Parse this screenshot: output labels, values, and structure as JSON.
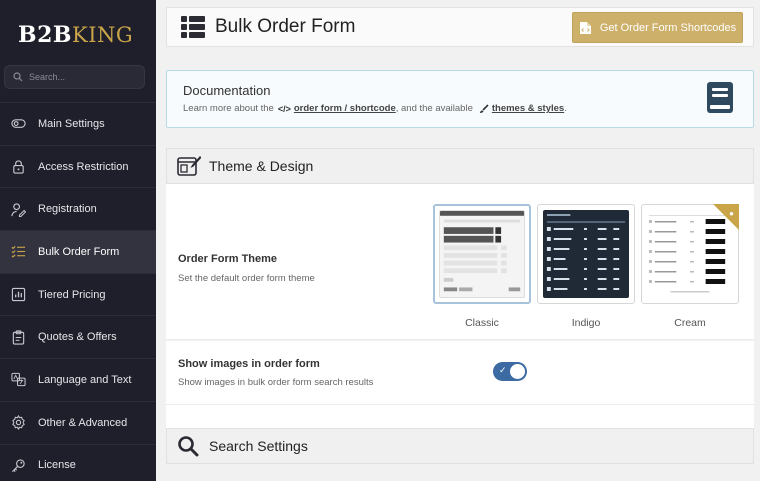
{
  "brand": {
    "logo_b2b": "B2B",
    "logo_king": "KING",
    "accent": "#c9a449"
  },
  "sidebar": {
    "search_placeholder": "Search...",
    "items": [
      {
        "label": "Main Settings",
        "icon": "circle-toggle-icon"
      },
      {
        "label": "Access Restriction",
        "icon": "lock-icon"
      },
      {
        "label": "Registration",
        "icon": "user-edit-icon"
      },
      {
        "label": "Bulk Order Form",
        "icon": "list-check-icon",
        "active": true
      },
      {
        "label": "Tiered Pricing",
        "icon": "chart-icon"
      },
      {
        "label": "Quotes & Offers",
        "icon": "clipboard-icon"
      },
      {
        "label": "Language and Text",
        "icon": "language-icon"
      },
      {
        "label": "Other & Advanced",
        "icon": "gear-icon"
      },
      {
        "label": "License",
        "icon": "key-icon"
      }
    ]
  },
  "header": {
    "title": "Bulk Order Form",
    "shortcodes_button": "Get Order Form Shortcodes"
  },
  "documentation": {
    "title": "Documentation",
    "text_before": "Learn more about the",
    "link1": "order form / shortcode",
    "text_middle": ", and the available",
    "link2": "themes & styles",
    "text_after": "."
  },
  "theme_section": {
    "title": "Theme & Design",
    "setting_title": "Order Form Theme",
    "setting_desc": "Set the default order form theme",
    "themes": [
      {
        "label": "Classic",
        "selected": true
      },
      {
        "label": "Indigo",
        "selected": false
      },
      {
        "label": "Cream",
        "selected": false,
        "premium": true
      }
    ]
  },
  "images_setting": {
    "title": "Show images in order form",
    "desc": "Show images in bulk order form search results",
    "enabled": true
  },
  "search_section": {
    "title": "Search Settings"
  }
}
